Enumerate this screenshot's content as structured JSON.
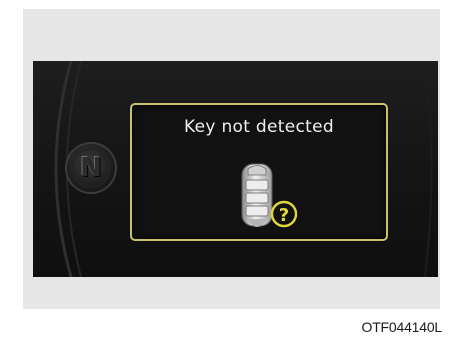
{
  "cluster_display": {
    "gear_indicator": "N",
    "message": "Key not detected",
    "key_icon": "smart-key-fob-question-icon",
    "question_mark": "?",
    "accent_color": "#e1d93a",
    "border_color": "#c7c36a"
  },
  "figure_code": "OTF044140L"
}
